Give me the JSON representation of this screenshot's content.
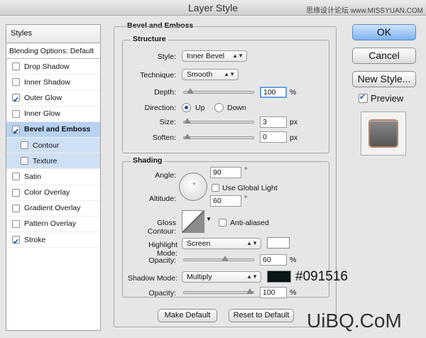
{
  "window": {
    "title": "Layer Style",
    "watermark_top": "思缘设计论坛  www.MISSYUAN.COM"
  },
  "styles_panel": {
    "header": "Styles",
    "blending": "Blending Options: Default",
    "items": [
      {
        "label": "Drop Shadow",
        "checked": false
      },
      {
        "label": "Inner Shadow",
        "checked": false
      },
      {
        "label": "Outer Glow",
        "checked": true
      },
      {
        "label": "Inner Glow",
        "checked": false
      },
      {
        "label": "Bevel and Emboss",
        "checked": true
      },
      {
        "label": "Contour",
        "checked": false
      },
      {
        "label": "Texture",
        "checked": false
      },
      {
        "label": "Satin",
        "checked": false
      },
      {
        "label": "Color Overlay",
        "checked": false
      },
      {
        "label": "Gradient Overlay",
        "checked": false
      },
      {
        "label": "Pattern Overlay",
        "checked": false
      },
      {
        "label": "Stroke",
        "checked": true
      }
    ]
  },
  "bevel": {
    "section_title": "Bevel and Emboss",
    "structure_title": "Structure",
    "style_label": "Style:",
    "style_value": "Inner Bevel",
    "technique_label": "Technique:",
    "technique_value": "Smooth",
    "depth_label": "Depth:",
    "depth_value": "100",
    "depth_unit": "%",
    "depth_level": 0.05,
    "direction_label": "Direction:",
    "dir_up": "Up",
    "dir_down": "Down",
    "size_label": "Size:",
    "size_value": "3",
    "size_unit": "px",
    "size_level": 0.0,
    "soften_label": "Soften:",
    "soften_value": "0",
    "soften_unit": "px",
    "soften_level": 0.0
  },
  "shading": {
    "title": "Shading",
    "angle_label": "Angle:",
    "angle_value": "90",
    "angle_unit": "°",
    "global_light": "Use Global Light",
    "altitude_label": "Altitude:",
    "altitude_value": "60",
    "altitude_unit": "°",
    "gloss_label": "Gloss Contour:",
    "anti_aliased": "Anti-aliased",
    "highlight_label": "Highlight Mode:",
    "highlight_value": "Screen",
    "highlight_color": "#ffffff",
    "hl_opacity_label": "Opacity:",
    "hl_opacity_value": "60",
    "hl_opacity_unit": "%",
    "hl_opacity_level": 0.6,
    "shadow_label": "Shadow Mode:",
    "shadow_value": "Multiply",
    "shadow_color": "#091516",
    "shadow_color_note": "#091516",
    "sh_opacity_label": "Opacity:",
    "sh_opacity_value": "100",
    "sh_opacity_unit": "%",
    "sh_opacity_level": 1.0
  },
  "buttons": {
    "make_default": "Make Default",
    "reset_default": "Reset to Default"
  },
  "side": {
    "ok": "OK",
    "cancel": "Cancel",
    "new_style": "New Style...",
    "preview": "Preview"
  },
  "watermark_bottom": "UiBQ.CoM"
}
